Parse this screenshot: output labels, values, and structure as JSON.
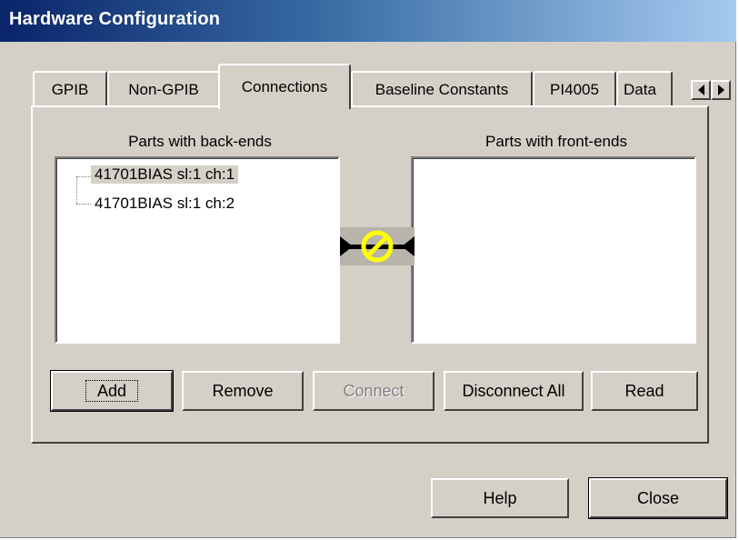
{
  "window": {
    "title": "Hardware Configuration"
  },
  "tabs": [
    {
      "label": "GPIB",
      "active": false
    },
    {
      "label": "Non-GPIB",
      "active": false
    },
    {
      "label": "Connections",
      "active": true
    },
    {
      "label": "Baseline Constants",
      "active": false
    },
    {
      "label": "PI4005",
      "active": false
    },
    {
      "label": "Data",
      "active": false
    }
  ],
  "tab_scroll": {
    "left_icon": "arrow-left-icon",
    "right_icon": "arrow-right-icon"
  },
  "connections": {
    "back_ends_header": "Parts with back-ends",
    "front_ends_header": "Parts with front-ends",
    "back_ends_items": [
      {
        "label": "41701BIAS sl:1 ch:1",
        "selected": true
      },
      {
        "label": "41701BIAS sl:1 ch:2",
        "selected": false
      }
    ],
    "front_ends_items": [],
    "connector_icon": "disconnected-icon",
    "connector_color": "#ffff00"
  },
  "actions": {
    "add": "Add",
    "remove": "Remove",
    "connect": "Connect",
    "disconnect_all": "Disconnect All",
    "read": "Read"
  },
  "footer": {
    "help": "Help",
    "close": "Close"
  }
}
